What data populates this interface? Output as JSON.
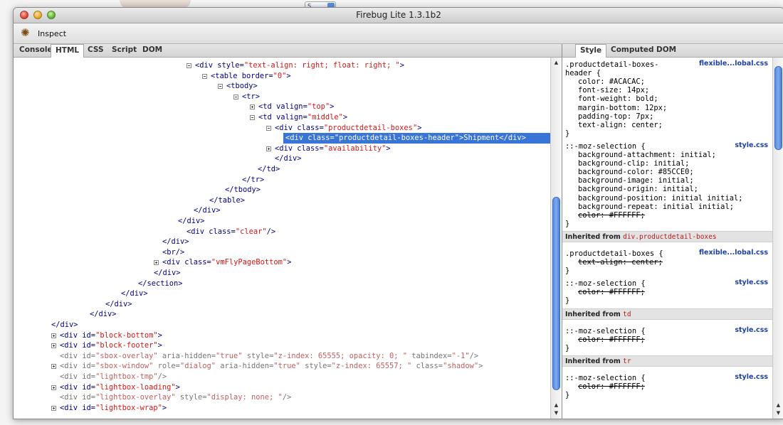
{
  "window": {
    "title": "Firebug Lite 1.3.1b2"
  },
  "toolbar": {
    "inspect_label": "Inspect"
  },
  "background": {
    "select_value": "S"
  },
  "tabs": [
    {
      "label": "Console",
      "selected": false
    },
    {
      "label": "HTML",
      "selected": true
    },
    {
      "label": "CSS",
      "selected": false
    },
    {
      "label": "Script",
      "selected": false
    },
    {
      "label": "DOM",
      "selected": false
    }
  ],
  "side_tabs": [
    {
      "label": "Style",
      "selected": true
    },
    {
      "label": "Computed",
      "selected": false
    },
    {
      "label": "DOM",
      "selected": false
    }
  ],
  "html_tree": [
    [
      [
        "tg",
        "<div "
      ],
      [
        "an",
        "style="
      ],
      [
        "av",
        "\"text-align: right; float: right; \""
      ],
      [
        "tg",
        ">"
      ]
    ],
    [
      [
        "tg",
        "<table "
      ],
      [
        "an",
        "border="
      ],
      [
        "av",
        "\"0\""
      ],
      [
        "tg",
        ">"
      ]
    ],
    [
      [
        "tg",
        "<tbody>"
      ]
    ],
    [
      [
        "tg",
        "<tr>"
      ]
    ],
    [
      [
        "tg",
        "<td "
      ],
      [
        "an",
        "valign="
      ],
      [
        "av",
        "\"top\""
      ],
      [
        "tg",
        ">"
      ]
    ],
    [
      [
        "tg",
        "<td "
      ],
      [
        "an",
        "valign="
      ],
      [
        "av",
        "\"middle\""
      ],
      [
        "tg",
        ">"
      ]
    ],
    [
      [
        "tg",
        "<div "
      ],
      [
        "an",
        "class="
      ],
      [
        "av",
        "\"productdetail-boxes\""
      ],
      [
        "tg",
        ">"
      ]
    ],
    [
      [
        "tg",
        "<div "
      ],
      [
        "an",
        "class="
      ],
      [
        "av",
        "\"productdetail-boxes-header\""
      ],
      [
        "tg",
        ">"
      ],
      [
        "tx",
        "Shipment"
      ],
      [
        "tg",
        "</div>"
      ]
    ],
    [
      [
        "tg",
        "<div "
      ],
      [
        "an",
        "class="
      ],
      [
        "av",
        "\"availability\""
      ],
      [
        "tg",
        ">"
      ]
    ],
    [
      [
        "tg",
        "</div>"
      ]
    ],
    [
      [
        "tg",
        "</td>"
      ]
    ],
    [
      [
        "tg",
        "</tr>"
      ]
    ],
    [
      [
        "tg",
        "</tbody>"
      ]
    ],
    [
      [
        "tg",
        "</table>"
      ]
    ],
    [
      [
        "tg",
        "</div>"
      ]
    ],
    [
      [
        "tg",
        "</div>"
      ]
    ],
    [
      [
        "tg",
        "<div "
      ],
      [
        "an",
        "class="
      ],
      [
        "av",
        "\"clear\""
      ],
      [
        "tg",
        "/>"
      ]
    ],
    [
      [
        "tg",
        "</div>"
      ]
    ],
    [
      [
        "tg",
        "<br/>"
      ]
    ],
    [
      [
        "tg",
        "<div "
      ],
      [
        "an",
        "class="
      ],
      [
        "av",
        "\"vmFlyPageBottom\""
      ],
      [
        "tg",
        ">"
      ]
    ],
    [
      [
        "tg",
        "</div>"
      ]
    ],
    [
      [
        "tg",
        "</section>"
      ]
    ],
    [
      [
        "tg",
        "</div>"
      ]
    ],
    [
      [
        "tg",
        "</div>"
      ]
    ],
    [
      [
        "tg",
        "</div>"
      ]
    ],
    [
      [
        "tg",
        "</div>"
      ]
    ],
    [
      [
        "tg",
        "<div "
      ],
      [
        "an",
        "id="
      ],
      [
        "av",
        "\"block-bottom\""
      ],
      [
        "tg",
        ">"
      ]
    ],
    [
      [
        "tg",
        "<div "
      ],
      [
        "an",
        "id="
      ],
      [
        "av",
        "\"block-footer\""
      ],
      [
        "tg",
        ">"
      ]
    ],
    [
      [
        "tg",
        "<div "
      ],
      [
        "an",
        "id="
      ],
      [
        "av",
        "\"sbox-overlay\""
      ],
      [
        "an",
        " aria-hidden="
      ],
      [
        "av",
        "\"true\""
      ],
      [
        "an",
        " style="
      ],
      [
        "av",
        "\"z-index: 65555; opacity: 0; \""
      ],
      [
        "an",
        " tabindex="
      ],
      [
        "av",
        "\"-1\""
      ],
      [
        "tg",
        "/>"
      ]
    ],
    [
      [
        "tg",
        "<div "
      ],
      [
        "an",
        "id="
      ],
      [
        "av",
        "\"sbox-window\""
      ],
      [
        "an",
        " role="
      ],
      [
        "av",
        "\"dialog\""
      ],
      [
        "an",
        " aria-hidden="
      ],
      [
        "av",
        "\"true\""
      ],
      [
        "an",
        " style="
      ],
      [
        "av",
        "\"z-index: 65557; \""
      ],
      [
        "an",
        " class="
      ],
      [
        "av",
        "\"shadow\""
      ],
      [
        "tg",
        ">"
      ]
    ],
    [
      [
        "tg",
        "<div "
      ],
      [
        "an",
        "id="
      ],
      [
        "av",
        "\"lightbox-tmp\""
      ],
      [
        "tg",
        "/>"
      ]
    ],
    [
      [
        "tg",
        "<div "
      ],
      [
        "an",
        "id="
      ],
      [
        "av",
        "\"lightbox-loading\""
      ],
      [
        "tg",
        ">"
      ]
    ],
    [
      [
        "tg",
        "<div "
      ],
      [
        "an",
        "id="
      ],
      [
        "av",
        "\"lightbox-overlay\""
      ],
      [
        "an",
        " style="
      ],
      [
        "av",
        "\"display: none; \""
      ],
      [
        "tg",
        "/>"
      ]
    ],
    [
      [
        "tg",
        "<div "
      ],
      [
        "an",
        "id="
      ],
      [
        "av",
        "\"lightbox-wrap\""
      ],
      [
        "tg",
        ">"
      ]
    ]
  ],
  "style_sources": {
    "flexible": "flexible...lobal.css",
    "style": "style.css"
  },
  "style_rules": [
    {
      "lines": [
        ".productdetail-boxes-",
        "header {"
      ],
      "source": "flexible...lobal.css",
      "props": [
        "color: #ACACAC;",
        "font-size: 14px;",
        "font-weight: bold;",
        "margin-bottom: 12px;",
        "padding-top: 7px;",
        "text-align: center;"
      ],
      "struck": []
    },
    {
      "lines": [
        "::-moz-selection {"
      ],
      "source": "style.css",
      "props": [
        "background-attachment: initial;",
        "background-clip: initial;",
        "background-color: #85CCE0;",
        "background-image: initial;",
        "background-origin: initial;",
        "background-position: initial initial;",
        "background-repeat: initial initial;",
        "color: #FFFFFF;"
      ],
      "struck": [
        7
      ]
    }
  ],
  "inherited": [
    {
      "label": "Inherited from",
      "selector": "div",
      "selector_class": ".productdetail-boxes",
      "rules": [
        {
          "lines": [
            ".productdetail-boxes {"
          ],
          "source": "flexible...lobal.css",
          "props": [
            "text-align: center;"
          ],
          "struck": [
            0
          ]
        },
        {
          "lines": [
            "::-moz-selection {"
          ],
          "source": "style.css",
          "props": [
            "color: #FFFFFF;"
          ],
          "struck": [
            0
          ]
        }
      ]
    },
    {
      "label": "Inherited from",
      "selector": "td",
      "selector_class": "",
      "rules": [
        {
          "lines": [
            "::-moz-selection {"
          ],
          "source": "style.css",
          "props": [
            "color: #FFFFFF;"
          ],
          "struck": [
            0
          ]
        }
      ]
    },
    {
      "label": "Inherited from",
      "selector": "tr",
      "selector_class": "",
      "rules": [
        {
          "lines": [
            "::-moz-selection {"
          ],
          "source": "style.css",
          "props": [
            "color: #FFFFFF;"
          ],
          "struck": [
            0
          ]
        }
      ]
    }
  ],
  "colors": {
    "selection": "#3875d7",
    "tag": "#000088",
    "attr_value": "#d81515",
    "scroll_thumb": "#5b8de0"
  }
}
